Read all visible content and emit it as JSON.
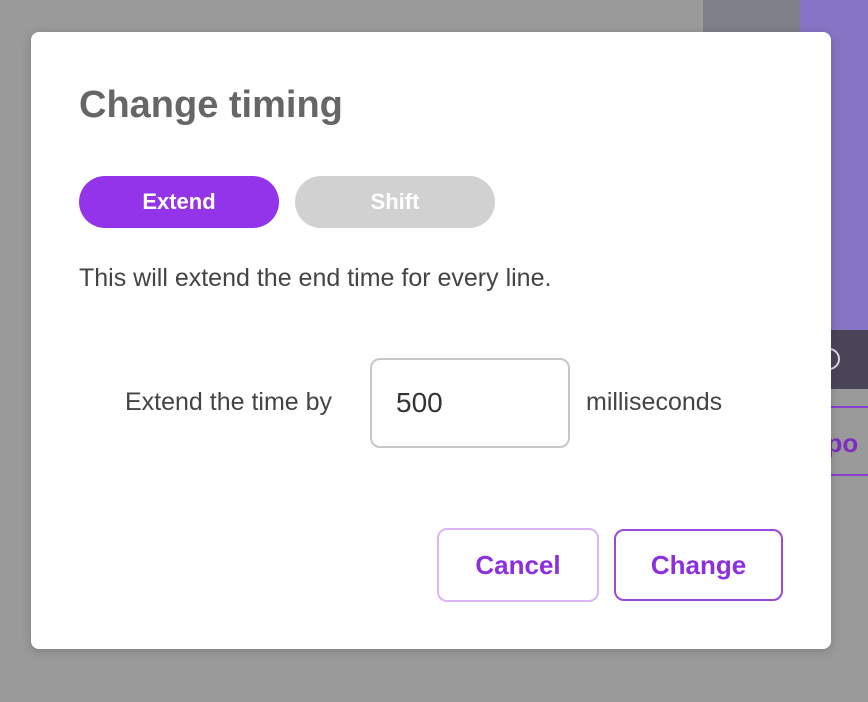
{
  "background": {
    "export_label_fragment": "xpo"
  },
  "dialog": {
    "title": "Change timing",
    "modes": [
      {
        "label": "Extend",
        "selected": true
      },
      {
        "label": "Shift",
        "selected": false
      }
    ],
    "description": "This will extend the end time for every line.",
    "extend_label": "Extend the time by",
    "input_value": "500",
    "unit_label": "milliseconds",
    "cancel_label": "Cancel",
    "change_label": "Change"
  },
  "colors": {
    "accent": "#9333ea",
    "inactive_toggle": "#d1d1d1",
    "overlay": "#9a9a9a"
  }
}
